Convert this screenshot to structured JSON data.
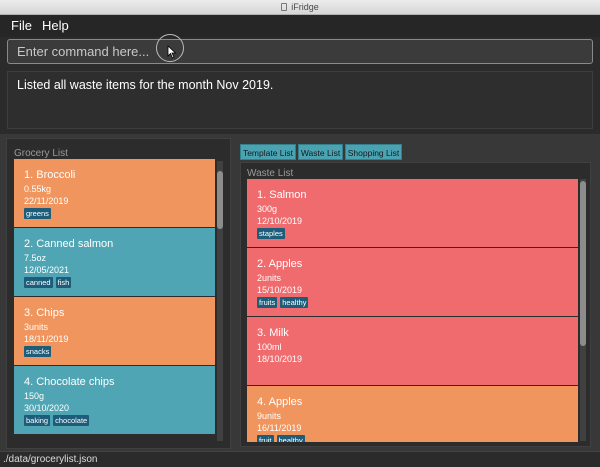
{
  "window": {
    "title": "iFridge"
  },
  "menu": {
    "file": "File",
    "help": "Help"
  },
  "command": {
    "placeholder": "Enter command here..."
  },
  "result": {
    "text": "Listed all waste items for the month Nov 2019."
  },
  "grocery": {
    "label": "Grocery List",
    "items": [
      {
        "name": "1.  Broccoli",
        "amount": "0.55kg",
        "date": "22/11/2019",
        "tags": [
          "greens"
        ],
        "color": "#f0955d"
      },
      {
        "name": "2.  Canned salmon",
        "amount": "7.5oz",
        "date": "12/05/2021",
        "tags": [
          "canned",
          "fish"
        ],
        "color": "#4fa5b3"
      },
      {
        "name": "3.  Chips",
        "amount": "3units",
        "date": "18/11/2019",
        "tags": [
          "snacks"
        ],
        "color": "#f0955d"
      },
      {
        "name": "4.  Chocolate chips",
        "amount": "150g",
        "date": "30/10/2020",
        "tags": [
          "baking",
          "chocolate"
        ],
        "color": "#4fa5b3"
      }
    ]
  },
  "tabs": {
    "template": "Template List",
    "waste": "Waste List",
    "shopping": "Shopping List"
  },
  "waste": {
    "label": "Waste List",
    "items": [
      {
        "name": "1.  Salmon",
        "amount": "300g",
        "date": "12/10/2019",
        "tags": [
          "staples"
        ],
        "color": "#f06b6e"
      },
      {
        "name": "2.  Apples",
        "amount": "2units",
        "date": "15/10/2019",
        "tags": [
          "fruits",
          "healthy"
        ],
        "color": "#f06b6e"
      },
      {
        "name": "3.  Milk",
        "amount": "100ml",
        "date": "18/10/2019",
        "tags": [],
        "color": "#f06b6e"
      },
      {
        "name": "4.  Apples",
        "amount": "9units",
        "date": "16/11/2019",
        "tags": [
          "fruit",
          "healthy"
        ],
        "color": "#f0955d"
      }
    ]
  },
  "status": {
    "path": "./data/grocerylist.json"
  }
}
